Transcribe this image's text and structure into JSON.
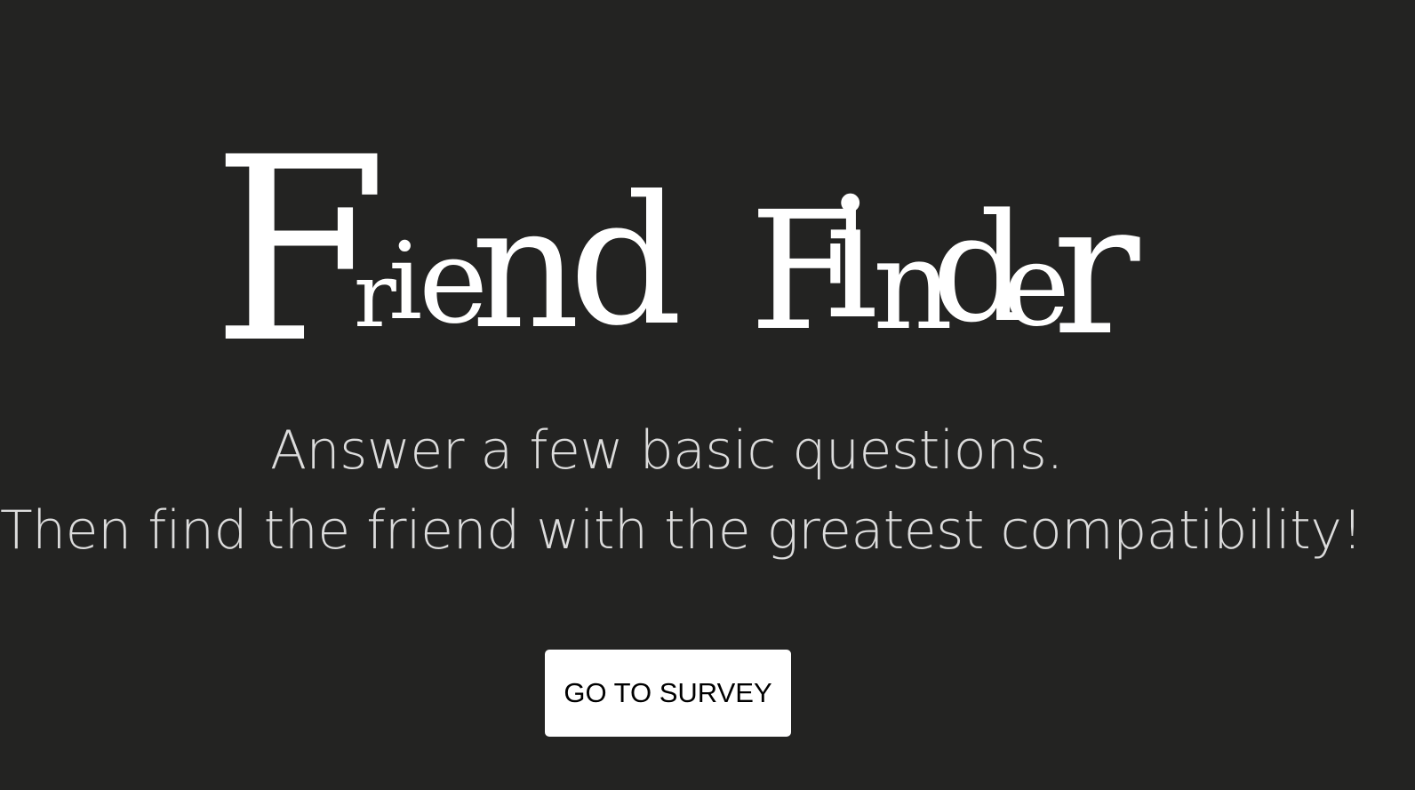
{
  "page": {
    "background_color": "#232322"
  },
  "header": {
    "title": "Friend Finder",
    "title_glyphs": [
      "F",
      "r",
      "i",
      "e",
      "n",
      "d",
      "F",
      "i",
      "n",
      "d",
      "e",
      "r"
    ]
  },
  "intro": {
    "line1": "Answer a few basic questions.",
    "line2": "Then find the friend with the greatest compatibility!"
  },
  "cta": {
    "label": "GO TO SURVEY"
  }
}
